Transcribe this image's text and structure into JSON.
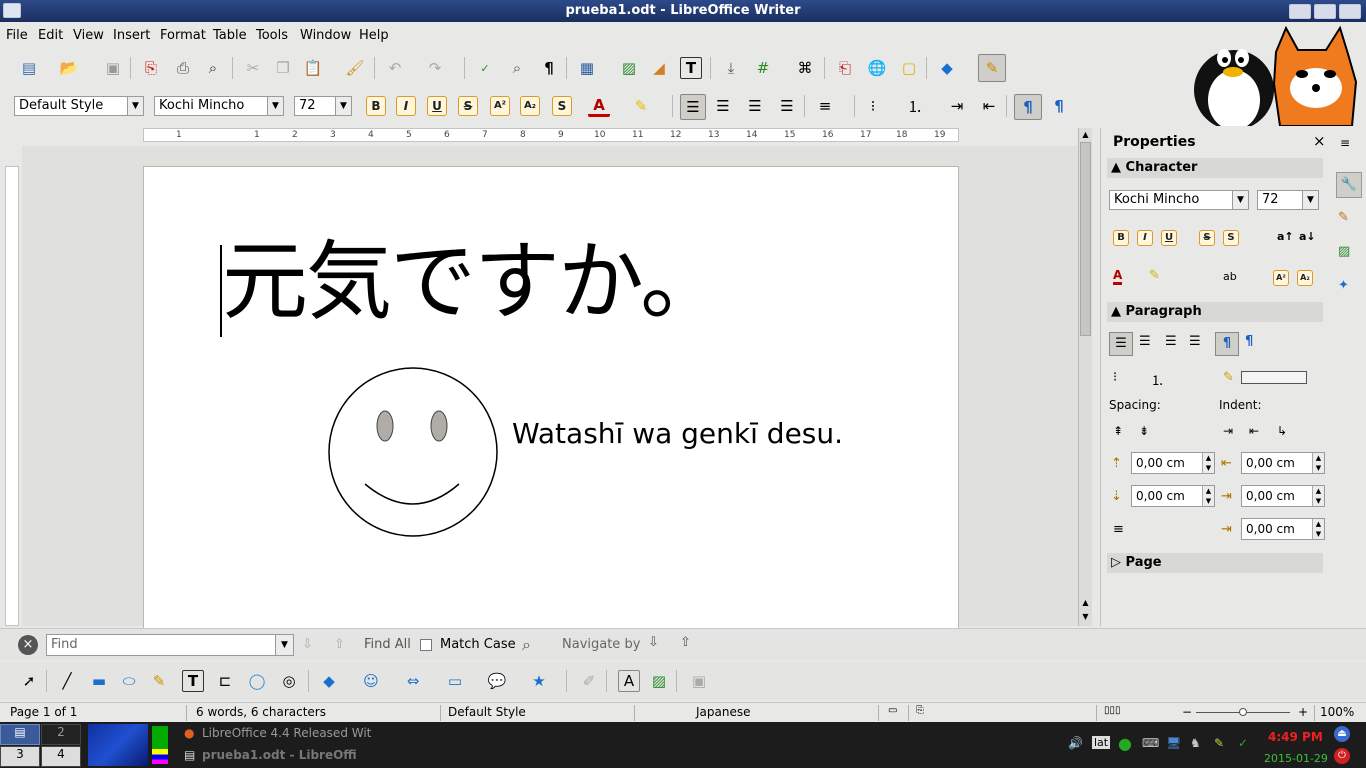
{
  "window": {
    "title": "prueba1.odt - LibreOffice Writer"
  },
  "menu": [
    "File",
    "Edit",
    "View",
    "Insert",
    "Format",
    "Table",
    "Tools",
    "Window",
    "Help"
  ],
  "formatting": {
    "paragraph_style": "Default Style",
    "font_name": "Kochi Mincho",
    "font_size": "72"
  },
  "ruler": {
    "ticks": [
      "1",
      "1",
      "2",
      "3",
      "4",
      "5",
      "6",
      "7",
      "8",
      "9",
      "10",
      "11",
      "12",
      "13",
      "14",
      "15",
      "16",
      "17",
      "18",
      "19"
    ]
  },
  "document": {
    "japanese_text": "元気ですか。",
    "caption_text": "Watashī wa genkī desu."
  },
  "sidebar": {
    "title": "Properties",
    "character_header": "Character",
    "font_name": "Kochi Mincho",
    "font_size": "72",
    "paragraph_header": "Paragraph",
    "spacing_label": "Spacing:",
    "indent_label": "Indent:",
    "above_spacing": "0,00 cm",
    "below_spacing": "0,00 cm",
    "before_indent": "0,00 cm",
    "after_indent": "0,00 cm",
    "first_line_indent": "0,00 cm",
    "page_header": "Page"
  },
  "findbar": {
    "placeholder": "Find",
    "find_all": "Find All",
    "match_case": "Match Case",
    "navigate_by": "Navigate by"
  },
  "status": {
    "page": "Page 1 of 1",
    "words": "6 words, 6 characters",
    "style": "Default Style",
    "language": "Japanese",
    "zoom": "100%"
  },
  "taskbar": {
    "workspaces": [
      "1",
      "2",
      "3",
      "4"
    ],
    "task1": "LibreOffice 4.4 Released Wit",
    "task2": "prueba1.odt - LibreOffi",
    "clock_time": "4:49 PM",
    "clock_date": "2015-01-29",
    "keyboard_layout": "lat"
  }
}
